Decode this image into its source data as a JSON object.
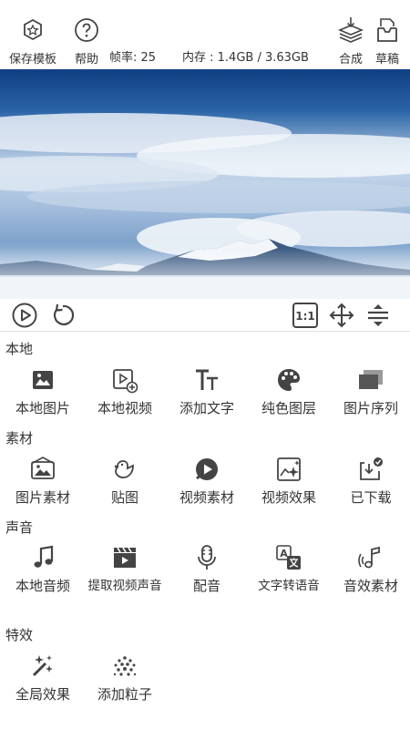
{
  "topbar": {
    "save_template": "保存模板",
    "help": "帮助",
    "fps": "帧率: 25",
    "memory": "内存 :  1.4GB / 3.63GB",
    "compose": "合成",
    "draft": "草稿"
  },
  "sections": {
    "local": {
      "title": "本地",
      "items": [
        "本地图片",
        "本地视频",
        "添加文字",
        "纯色图层",
        "图片序列"
      ]
    },
    "material": {
      "title": "素材",
      "items": [
        "图片素材",
        "贴图",
        "视频素材",
        "视频效果",
        "已下载"
      ]
    },
    "sound": {
      "title": "声音",
      "items": [
        "本地音频",
        "提取视频声音",
        "配音",
        "文字转语音",
        "音效素材"
      ]
    },
    "effects": {
      "title": "特效",
      "items": [
        "全局效果",
        "添加粒子"
      ]
    }
  },
  "colors": {
    "icon": "#444444",
    "divider": "#e2e2e2",
    "sky": "#2f6aa8"
  }
}
